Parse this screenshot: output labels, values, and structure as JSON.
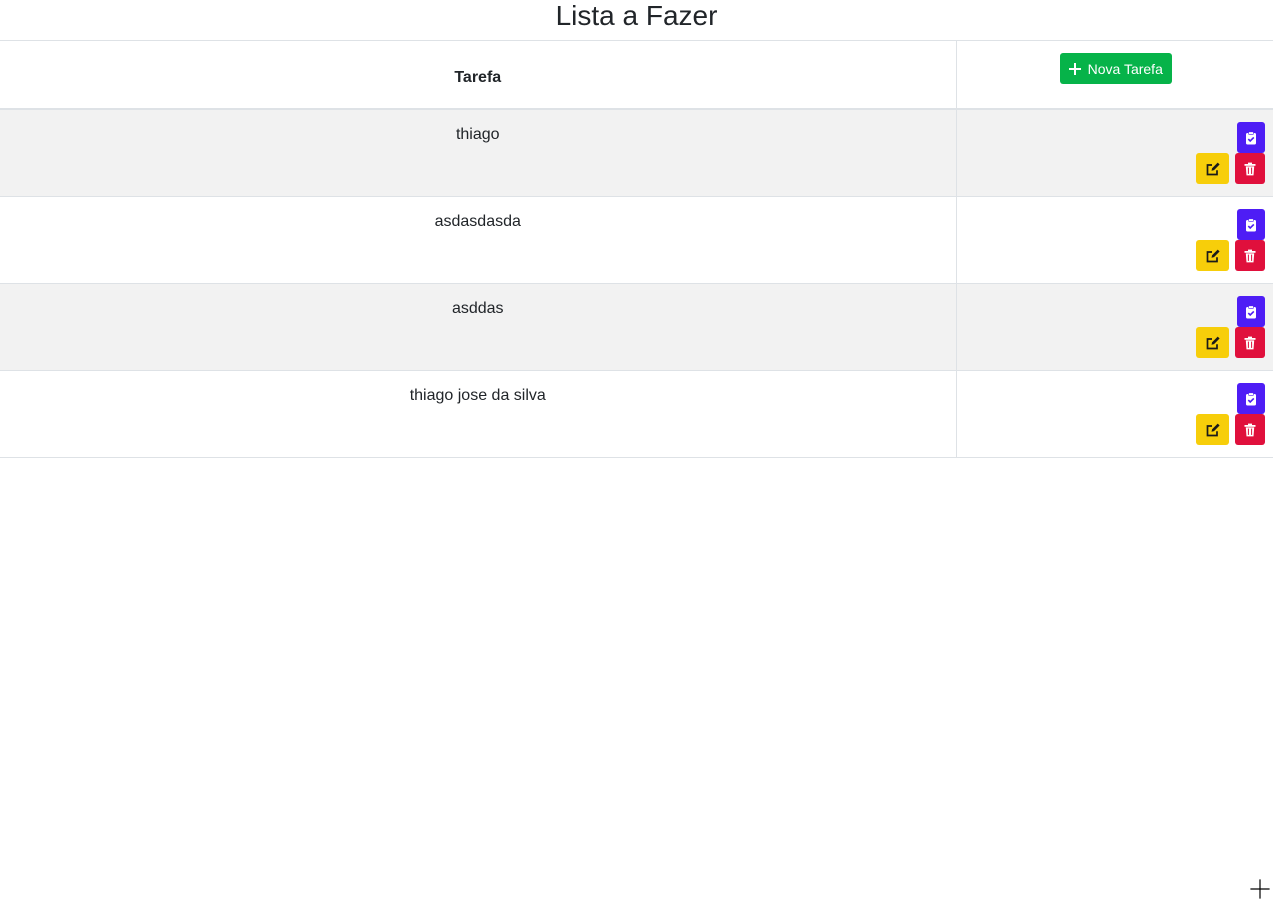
{
  "page": {
    "title": "Lista a Fazer"
  },
  "table": {
    "header_task": "Tarefa",
    "new_button_label": "Nova Tarefa",
    "rows": [
      {
        "task": "thiago"
      },
      {
        "task": "asdasdasda"
      },
      {
        "task": "asddas"
      },
      {
        "task": "thiago jose da silva"
      }
    ]
  },
  "icons": {
    "new": "plus-icon",
    "complete": "clipboard-check-icon",
    "edit": "edit-icon",
    "delete": "trash-icon"
  },
  "colors": {
    "new_button": "#06b349",
    "complete_button": "#4e1df5",
    "edit_button": "#f7ce0a",
    "delete_button": "#e0103c",
    "stripe": "#f2f2f2"
  }
}
